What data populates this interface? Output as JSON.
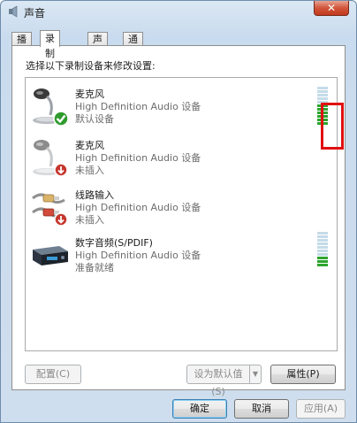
{
  "window": {
    "title": "声音",
    "close_glyph": "✕"
  },
  "tabs": [
    {
      "label": "播放",
      "active": false
    },
    {
      "label": "录制",
      "active": true
    },
    {
      "label": "声音",
      "active": false
    },
    {
      "label": "通信",
      "active": false
    }
  ],
  "instruction": "选择以下录制设备来修改设置:",
  "devices": [
    {
      "name": "麦克风",
      "desc": "High Definition Audio 设备",
      "status": "默认设备",
      "icon": "microphone-default-icon",
      "level": 0.55
    },
    {
      "name": "麦克风",
      "desc": "High Definition Audio 设备",
      "status": "未插入",
      "icon": "microphone-unplugged-icon"
    },
    {
      "name": "线路输入",
      "desc": "High Definition Audio 设备",
      "status": "未插入",
      "icon": "line-in-unplugged-icon"
    },
    {
      "name": "数字音频(S/PDIF)",
      "desc": "High Definition Audio 设备",
      "status": "准备就绪",
      "icon": "spdif-device-icon",
      "level": 0.3
    }
  ],
  "buttons": {
    "configure": "配置(C)",
    "set_default": "设为默认值(S)",
    "properties": "属性(P)",
    "ok": "确定",
    "cancel": "取消",
    "apply": "应用(A)"
  },
  "colors": {
    "meter_active": "#2ea52e",
    "meter_inactive": "#c5dbe8",
    "highlight": "#e01010"
  }
}
